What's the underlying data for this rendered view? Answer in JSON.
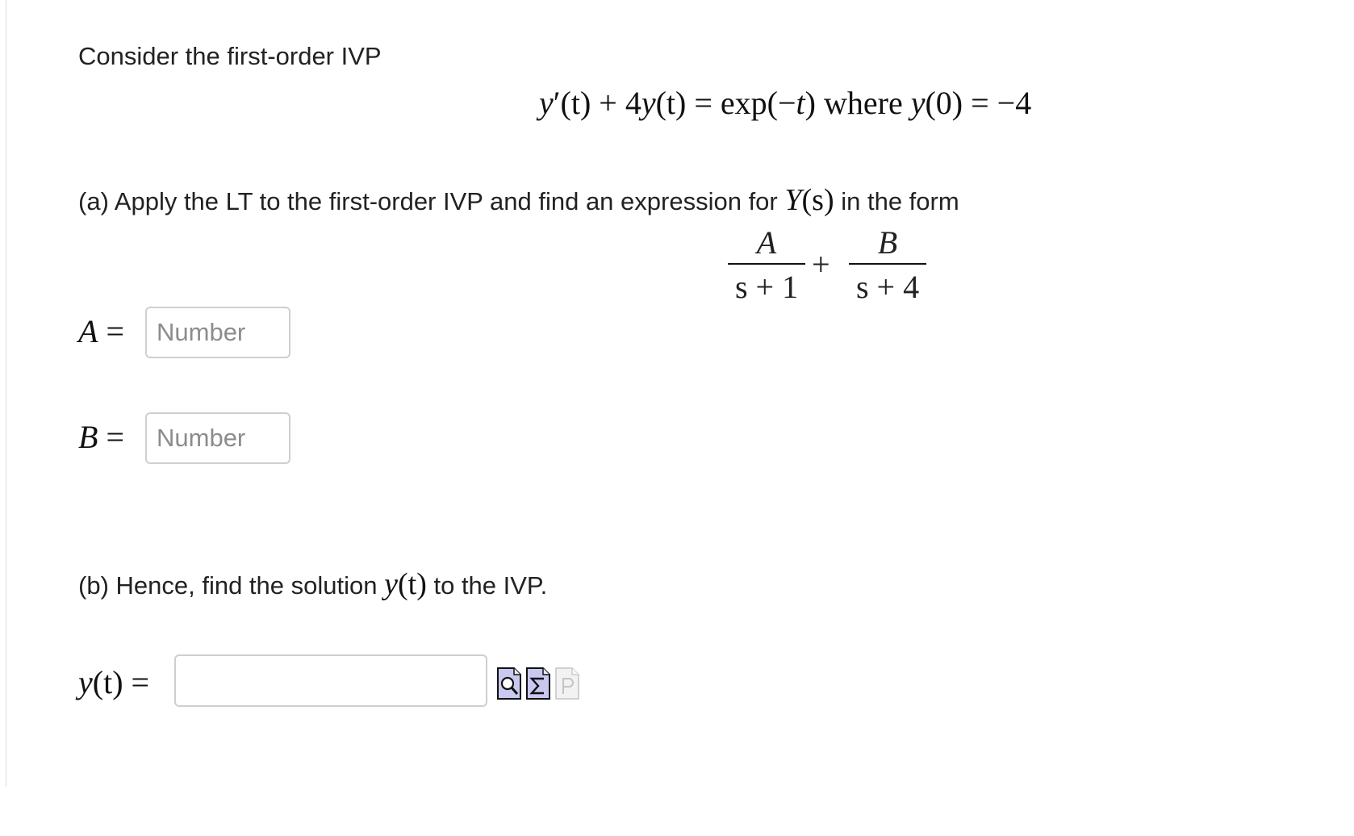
{
  "intro": "Consider the first-order IVP",
  "equation": {
    "lhs_y": "y",
    "lhs_prime": "′",
    "lhs_paren_t": "(t) + 4",
    "lhs_y2": "y",
    "lhs_t2": "(t) = exp(−",
    "rhs_t": "t",
    "rhs_close": ")",
    "where_word": "where",
    "cond_y": "y",
    "cond_rest": "(0) = −4"
  },
  "part_a": {
    "prefix": "(a) Apply the LT to the first-order IVP and find an expression for ",
    "var_Y": "Y",
    "var_s": "(s)",
    "suffix": " in the form",
    "form": {
      "num1": "A",
      "den1": "s + 1",
      "plus": "+",
      "num2": "B",
      "den2": "s + 4"
    },
    "field_a": {
      "label": "A",
      "equals": "=",
      "placeholder": "Number",
      "value": ""
    },
    "field_b": {
      "label": "B",
      "equals": "=",
      "placeholder": "Number",
      "value": ""
    }
  },
  "part_b": {
    "prefix": "(b) Hence, find the solution ",
    "var_y": "y",
    "var_t": "(t)",
    "suffix": " to the IVP.",
    "answer_label_y": "y",
    "answer_label_rest": "(t) =",
    "answer_value": ""
  },
  "tools": [
    {
      "name": "preview-icon",
      "color": "#c8c8f0"
    },
    {
      "name": "equation-editor-icon",
      "color": "#c8c8f0"
    },
    {
      "name": "help-icon-disabled",
      "color": "#eeeeee"
    }
  ]
}
